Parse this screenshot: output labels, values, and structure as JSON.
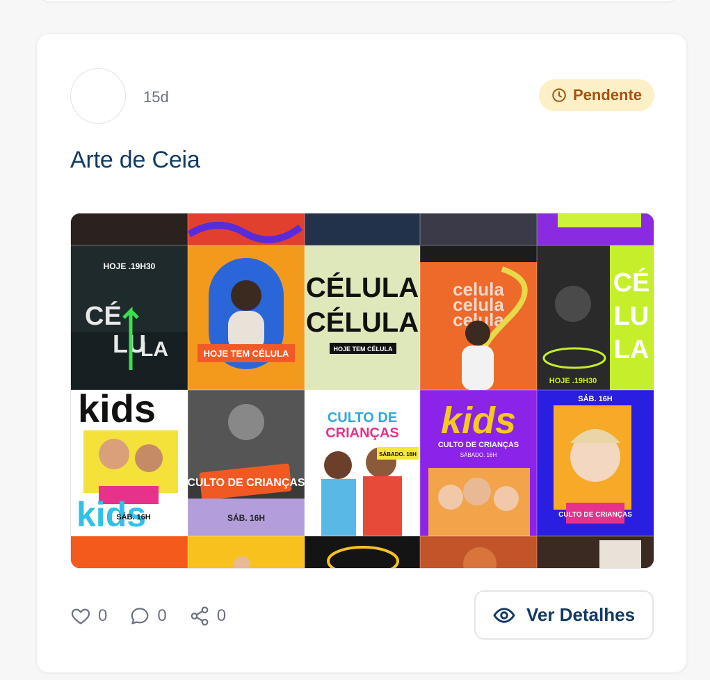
{
  "post": {
    "time_ago": "15d",
    "status": "Pendente",
    "title": "Arte de Ceia"
  },
  "gallery": {
    "image_alt": "Arte de Ceia",
    "tile_texts": {
      "hoje_1930": "HOJE .19H30",
      "ce": "CÉ",
      "lu": "LU",
      "la": "LA",
      "hoje_tem_celula": "HOJE TEM CÉLULA",
      "celula": "CÉLULA",
      "celula_lower": "celula",
      "kids": "kids",
      "culto_de_criancas": "CULTO DE CRIANÇAS",
      "culto_de": "CULTO DE",
      "criancas": "CRIANÇAS",
      "sab_16h": "SÁB. 16H",
      "sabado_16h": "SÁBADO. 16H"
    }
  },
  "actions": {
    "likes": "0",
    "comments": "0",
    "shares": "0",
    "details_label": "Ver Detalhes"
  },
  "colors": {
    "badge_bg": "#fdf0c6",
    "badge_text": "#a65212",
    "title": "#123a63",
    "muted": "#6b7280"
  }
}
